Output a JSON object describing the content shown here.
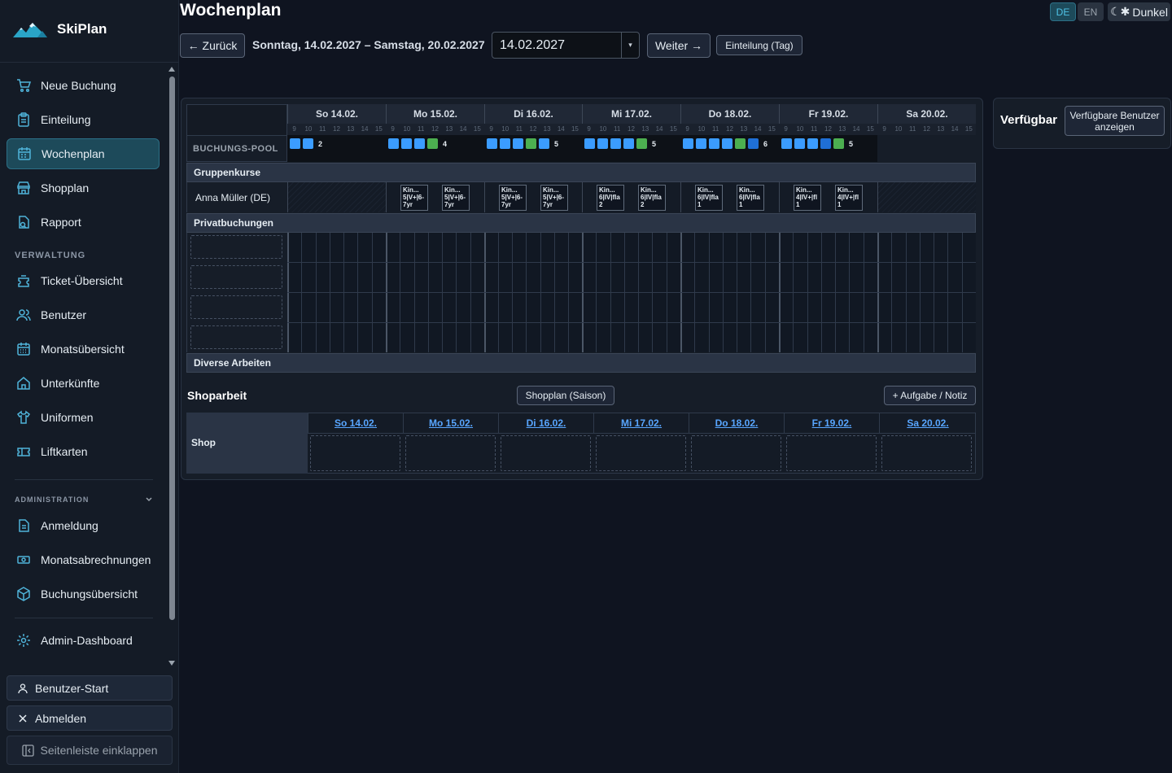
{
  "brand": {
    "name": "SkiPlan"
  },
  "sidebar": {
    "items": [
      {
        "label": "Neue Buchung",
        "icon": "cart-icon"
      },
      {
        "label": "Einteilung",
        "icon": "clipboard-icon"
      },
      {
        "label": "Wochenplan",
        "icon": "calendar-icon",
        "active": true
      },
      {
        "label": "Shopplan",
        "icon": "store-icon"
      },
      {
        "label": "Rapport",
        "icon": "report-icon"
      }
    ],
    "section_verwaltung": "VERWALTUNG",
    "verwaltung_items": [
      {
        "label": "Ticket-Übersicht",
        "icon": "ticket-icon"
      },
      {
        "label": "Benutzer",
        "icon": "users-icon"
      },
      {
        "label": "Monatsübersicht",
        "icon": "calendar-month-icon"
      },
      {
        "label": "Unterkünfte",
        "icon": "home-icon"
      },
      {
        "label": "Uniformen",
        "icon": "shirt-icon"
      },
      {
        "label": "Liftkarten",
        "icon": "ticket-card-icon"
      }
    ],
    "section_admin": "ADMINISTRATION",
    "admin_items": [
      {
        "label": "Anmeldung",
        "icon": "document-icon"
      },
      {
        "label": "Monatsabrechnungen",
        "icon": "money-icon"
      },
      {
        "label": "Buchungsübersicht",
        "icon": "box-icon"
      },
      {
        "label": "Admin-Dashboard",
        "icon": "gear-icon"
      }
    ],
    "user_start": "Benutzer-Start",
    "logout": "Abmelden",
    "collapse": "Seitenleiste einklappen"
  },
  "header": {
    "title": "Wochenplan",
    "lang_de": "DE",
    "lang_en": "EN",
    "theme": "Dunkel",
    "back": "← Zurück",
    "range": "Sonntag, 14.02.2027 – Samstag, 20.02.2027",
    "date_value": "14.02.2027",
    "next": "Weiter →",
    "day_view": "Einteilung (Tag)"
  },
  "schedule": {
    "days": [
      "So 14.02.",
      "Mo 15.02.",
      "Di 16.02.",
      "Mi 17.02.",
      "Do 18.02.",
      "Fr 19.02.",
      "Sa 20.02."
    ],
    "hours": [
      "9",
      "10",
      "11",
      "12",
      "13",
      "14",
      "15"
    ],
    "pool_label": "BUCHUNGS-POOL",
    "pool": [
      {
        "squares": [
          "#3b9cff",
          "#3b9cff"
        ],
        "count": "2"
      },
      {
        "squares": [
          "#3b9cff",
          "#3b9cff",
          "#3b9cff",
          "#4caf50"
        ],
        "count": "4"
      },
      {
        "squares": [
          "#3b9cff",
          "#3b9cff",
          "#3b9cff",
          "#4caf50",
          "#3b9cff"
        ],
        "count": "5"
      },
      {
        "squares": [
          "#3b9cff",
          "#3b9cff",
          "#3b9cff",
          "#3b9cff",
          "#4caf50"
        ],
        "count": "5"
      },
      {
        "squares": [
          "#3b9cff",
          "#3b9cff",
          "#3b9cff",
          "#3b9cff",
          "#4caf50",
          "#1f6fd6"
        ],
        "count": "6"
      },
      {
        "squares": [
          "#3b9cff",
          "#3b9cff",
          "#3b9cff",
          "#1f6fd6",
          "#4caf50"
        ],
        "count": "5"
      },
      {
        "squares": [],
        "count": ""
      }
    ],
    "section_group": "Gruppenkurse",
    "instructor": "Anna Müller (DE)",
    "courses": [
      [],
      [
        {
          "l1": "Kin...",
          "l2": "5|V+|6-",
          "l3": "7yr"
        },
        {
          "l1": "Kin...",
          "l2": "5|V+|6-",
          "l3": "7yr"
        }
      ],
      [
        {
          "l1": "Kin...",
          "l2": "5|V+|6-",
          "l3": "7yr"
        },
        {
          "l1": "Kin...",
          "l2": "5|V+|6-",
          "l3": "7yr"
        }
      ],
      [
        {
          "l1": "Kin...",
          "l2": "6|IV|fla",
          "l3": "2"
        },
        {
          "l1": "Kin...",
          "l2": "6|IV|fla",
          "l3": "2"
        }
      ],
      [
        {
          "l1": "Kin...",
          "l2": "6|IV|fla",
          "l3": "1"
        },
        {
          "l1": "Kin...",
          "l2": "6|IV|fla",
          "l3": "1"
        }
      ],
      [
        {
          "l1": "Kin...",
          "l2": "4|IV+|fl",
          "l3": "1"
        },
        {
          "l1": "Kin...",
          "l2": "4|IV+|fl",
          "l3": "1"
        }
      ],
      []
    ],
    "section_private": "Privatbuchungen",
    "section_misc": "Diverse Arbeiten"
  },
  "shop": {
    "title": "Shoparbeit",
    "season_btn": "Shopplan (Saison)",
    "task_btn": "+ Aufgabe / Notiz",
    "row_label": "Shop",
    "days": [
      "So 14.02.",
      "Mo 15.02.",
      "Di 16.02.",
      "Mi 17.02.",
      "Do 18.02.",
      "Fr 19.02.",
      "Sa 20.02."
    ]
  },
  "available": {
    "title": "Verfügbar",
    "button": "Verfügbare Benutzer anzeigen"
  },
  "colors": {
    "accent": "#1d4a5a",
    "link": "#58a6ff"
  }
}
